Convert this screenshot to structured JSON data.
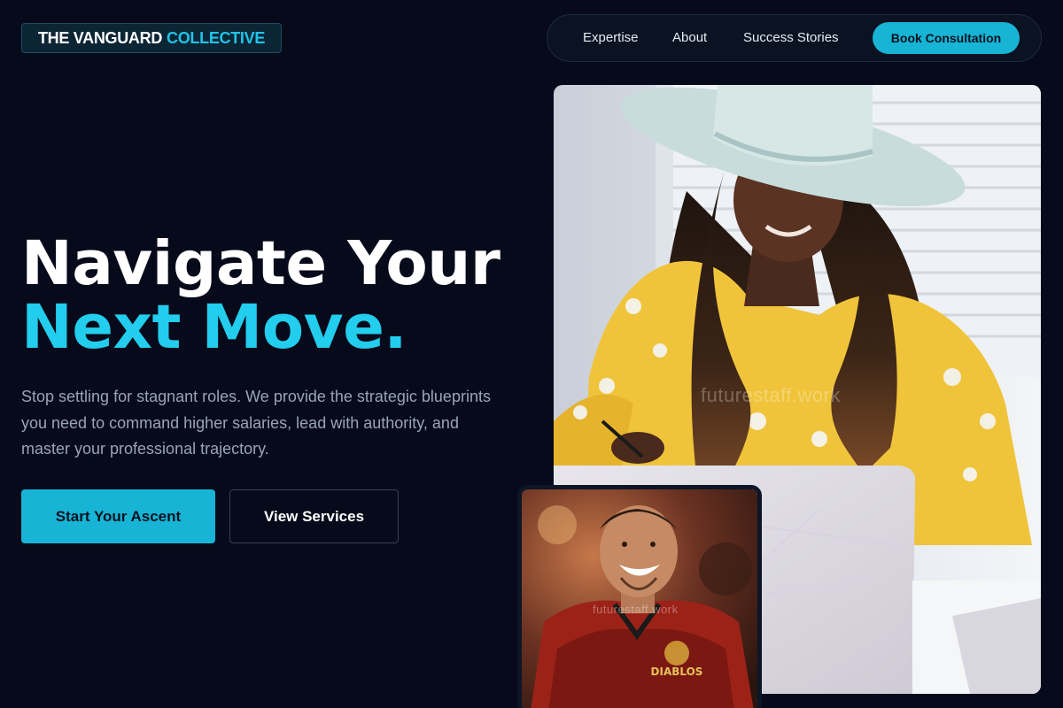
{
  "brand": {
    "name_white": "THE VANGUARD",
    "name_accent": "COLLECTIVE"
  },
  "nav": {
    "links": [
      "Expertise",
      "About",
      "Success Stories"
    ],
    "cta": "Book Consultation"
  },
  "hero": {
    "title_line1": "Navigate Your",
    "title_line2": "Next Move.",
    "subtitle": "Stop settling for stagnant roles. We provide the strategic blueprints you need to command higher salaries, lead with authority, and master your professional trajectory.",
    "primary_button": "Start Your Ascent",
    "secondary_button": "View Services"
  },
  "images": {
    "main_watermark": "futurestaff.work",
    "small_watermark": "futurestaff.work",
    "jersey_text": "DIABLOS"
  },
  "colors": {
    "background": "#060a1a",
    "accent": "#22cdee",
    "button": "#17b4d6"
  }
}
